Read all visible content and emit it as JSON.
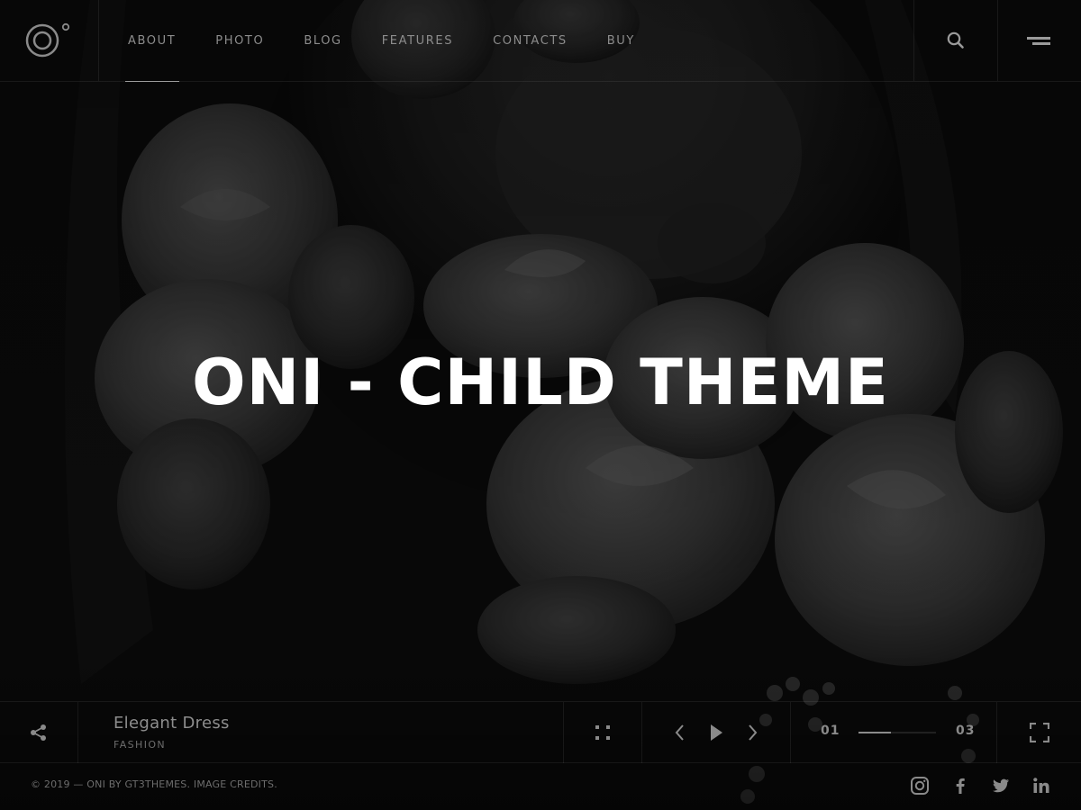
{
  "nav": {
    "items": [
      {
        "label": "ABOUT"
      },
      {
        "label": "PHOTO"
      },
      {
        "label": "BLOG"
      },
      {
        "label": "FEATURES"
      },
      {
        "label": "CONTACTS"
      },
      {
        "label": "BUY"
      }
    ],
    "active": "ABOUT"
  },
  "hero": {
    "title": "ONI - CHILD THEME"
  },
  "slide": {
    "title": "Elegant Dress",
    "category": "FASHION",
    "current": "01",
    "total": "03",
    "progress": 0.42
  },
  "footer": {
    "copyright": "© 2019 — ONI BY GT3THEMES. IMAGE CREDITS."
  },
  "icons": {
    "logo": "logo-icon",
    "search": "search-icon",
    "menu": "menu-icon",
    "share": "share-icon",
    "grid": "grid-icon",
    "prev": "chevron-left-icon",
    "play": "play-icon",
    "next": "chevron-right-icon",
    "fullscreen": "fullscreen-icon",
    "socials": [
      "instagram-icon",
      "facebook-icon",
      "twitter-icon",
      "linkedin-icon"
    ]
  },
  "colors": {
    "background": "#0b0b0b",
    "title": "#ffffff",
    "text_muted": "#8a8a8a"
  }
}
